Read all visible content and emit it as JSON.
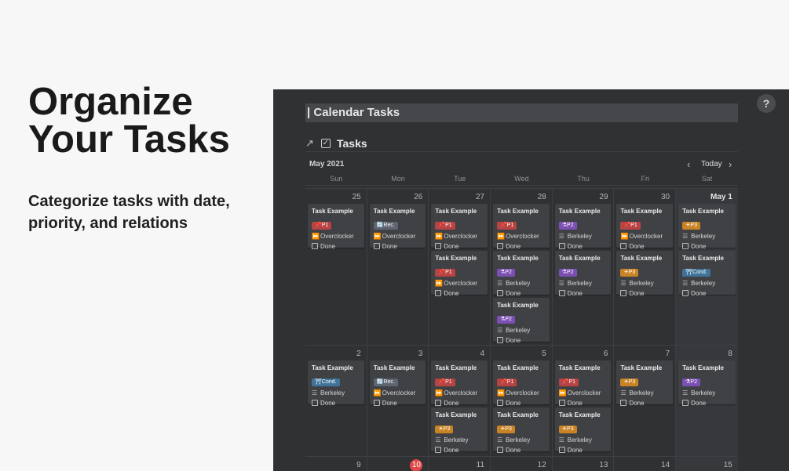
{
  "hero": {
    "title_line1": "Organize",
    "title_line2": "Your Tasks",
    "subtitle": "Categorize tasks with date, priority, and relations"
  },
  "app": {
    "help": "?",
    "page_title": "| Calendar Tasks",
    "db_arrow": "↗",
    "db_title": "Tasks",
    "month": "May 2021",
    "nav": {
      "prev": "‹",
      "today": "Today",
      "next": "›"
    },
    "weekdays": [
      "Sun",
      "Mon",
      "Tue",
      "Wed",
      "Thu",
      "Fri",
      "Sat"
    ],
    "weeks": [
      {
        "days": [
          {
            "num": "25",
            "cards": [
              {
                "title": "Task Example",
                "tag": "P1",
                "tagicon": "📌",
                "tagclass": "p1",
                "rel_icon": "⏩",
                "rel": "Overclocker",
                "done": "Done"
              }
            ]
          },
          {
            "num": "26",
            "cards": [
              {
                "title": "Task Example",
                "tag": "Rec.",
                "tagicon": "🔄",
                "tagclass": "rec",
                "rel_icon": "⏩",
                "rel": "Overclocker",
                "done": "Done"
              }
            ]
          },
          {
            "num": "27",
            "cards": [
              {
                "title": "Task Example",
                "tag": "P1",
                "tagicon": "📌",
                "tagclass": "p1",
                "rel_icon": "⏩",
                "rel": "Overclocker",
                "done": "Done"
              },
              {
                "title": "Task Example",
                "tag": "P1",
                "tagicon": "📌",
                "tagclass": "p1",
                "rel_icon": "⏩",
                "rel": "Overclocker",
                "done": "Done"
              }
            ]
          },
          {
            "num": "28",
            "cards": [
              {
                "title": "Task Example",
                "tag": "P1",
                "tagicon": "📌",
                "tagclass": "p1",
                "rel_icon": "⏩",
                "rel": "Overclocker",
                "done": "Done"
              },
              {
                "title": "Task Example",
                "tag": "P2",
                "tagicon": "⚗",
                "tagclass": "p2",
                "rel_icon": "☰",
                "rel": "Berkeley",
                "done": "Done"
              },
              {
                "title": "Task Example",
                "tag": "P2",
                "tagicon": "⚗",
                "tagclass": "p2",
                "rel_icon": "☰",
                "rel": "Berkeley",
                "done": "Done"
              }
            ]
          },
          {
            "num": "29",
            "cards": [
              {
                "title": "Task Example",
                "tag": "P2",
                "tagicon": "⚗",
                "tagclass": "p2",
                "rel_icon": "☰",
                "rel": "Berkeley",
                "done": "Done"
              },
              {
                "title": "Task Example",
                "tag": "P2",
                "tagicon": "⚗",
                "tagclass": "p2",
                "rel_icon": "☰",
                "rel": "Berkeley",
                "done": "Done"
              }
            ]
          },
          {
            "num": "30",
            "cards": [
              {
                "title": "Task Example",
                "tag": "P1",
                "tagicon": "📌",
                "tagclass": "p1",
                "rel_icon": "⏩",
                "rel": "Overclocker",
                "done": "Done"
              },
              {
                "title": "Task Example",
                "tag": "P3",
                "tagicon": "☀",
                "tagclass": "p3",
                "rel_icon": "☰",
                "rel": "Berkeley",
                "done": "Done"
              }
            ]
          },
          {
            "num": "May 1",
            "strong": true,
            "cards": [
              {
                "title": "Task Example",
                "tag": "P3",
                "tagicon": "☀",
                "tagclass": "p3",
                "rel_icon": "☰",
                "rel": "Berkeley",
                "done": "Done"
              },
              {
                "title": "Task Example",
                "tag": "Cond.",
                "tagicon": "⛩",
                "tagclass": "cond",
                "rel_icon": "☰",
                "rel": "Berkeley",
                "done": "Done"
              }
            ]
          }
        ]
      },
      {
        "days": [
          {
            "num": "2",
            "cards": [
              {
                "title": "Task Example",
                "tag": "Cond.",
                "tagicon": "⛩",
                "tagclass": "cond",
                "rel_icon": "☰",
                "rel": "Berkeley",
                "done": "Done"
              }
            ]
          },
          {
            "num": "3",
            "cards": [
              {
                "title": "Task Example",
                "tag": "Rec.",
                "tagicon": "🔄",
                "tagclass": "rec",
                "rel_icon": "⏩",
                "rel": "Overclocker",
                "done": "Done"
              }
            ]
          },
          {
            "num": "4",
            "cards": [
              {
                "title": "Task Example",
                "tag": "P1",
                "tagicon": "📌",
                "tagclass": "p1",
                "rel_icon": "⏩",
                "rel": "Overclocker",
                "done": "Done"
              },
              {
                "title": "Task Example",
                "tag": "P3",
                "tagicon": "☀",
                "tagclass": "p3",
                "rel_icon": "☰",
                "rel": "Berkeley",
                "done": "Done"
              }
            ]
          },
          {
            "num": "5",
            "cards": [
              {
                "title": "Task Example",
                "tag": "P1",
                "tagicon": "📌",
                "tagclass": "p1",
                "rel_icon": "⏩",
                "rel": "Overclocker",
                "done": "Done"
              },
              {
                "title": "Task Example",
                "tag": "P3",
                "tagicon": "☀",
                "tagclass": "p3",
                "rel_icon": "☰",
                "rel": "Berkeley",
                "done": "Done"
              }
            ]
          },
          {
            "num": "6",
            "cards": [
              {
                "title": "Task Example",
                "tag": "P1",
                "tagicon": "📌",
                "tagclass": "p1",
                "rel_icon": "⏩",
                "rel": "Overclocker",
                "done": "Done"
              },
              {
                "title": "Task Example",
                "tag": "P3",
                "tagicon": "☀",
                "tagclass": "p3",
                "rel_icon": "☰",
                "rel": "Berkeley",
                "done": "Done"
              }
            ]
          },
          {
            "num": "7",
            "cards": [
              {
                "title": "Task Example",
                "tag": "P3",
                "tagicon": "☀",
                "tagclass": "p3",
                "rel_icon": "☰",
                "rel": "Berkeley",
                "done": "Done"
              }
            ]
          },
          {
            "num": "8",
            "cards": [
              {
                "title": "Task Example",
                "tag": "P2",
                "tagicon": "⚗",
                "tagclass": "p2",
                "rel_icon": "☰",
                "rel": "Berkeley",
                "done": "Done"
              }
            ]
          }
        ]
      },
      {
        "days": [
          {
            "num": "9",
            "cards": []
          },
          {
            "num": "10",
            "today": true,
            "cards": []
          },
          {
            "num": "11",
            "cards": []
          },
          {
            "num": "12",
            "cards": []
          },
          {
            "num": "13",
            "cards": []
          },
          {
            "num": "14",
            "cards": []
          },
          {
            "num": "15",
            "cards": []
          }
        ]
      }
    ]
  }
}
